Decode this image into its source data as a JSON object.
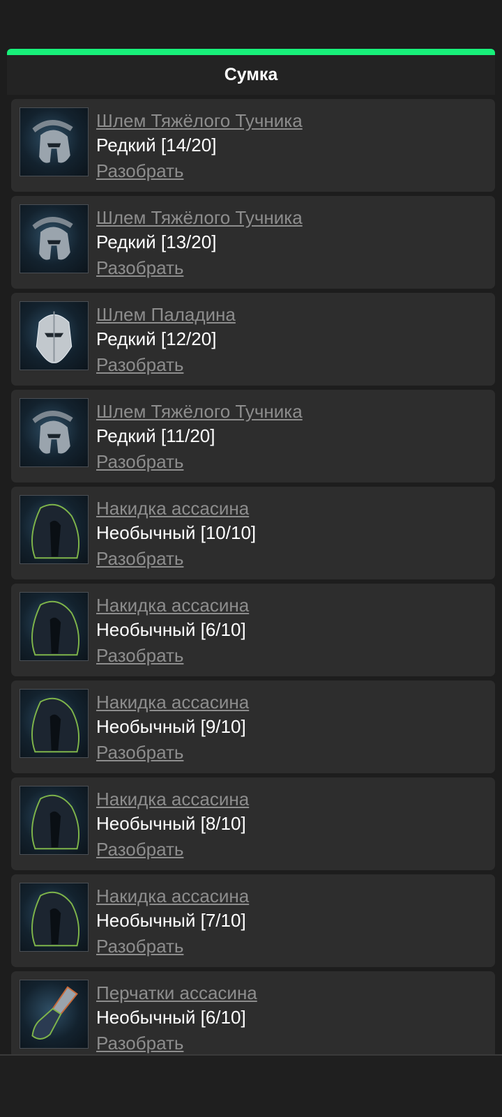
{
  "header": {
    "title": "Сумка",
    "accent": "#18f07a"
  },
  "items": [
    {
      "name": "Шлем Тяжёлого Тучника",
      "rarity": "Редкий [14/20]",
      "action": "Разобрать",
      "icon": "spartan-helmet-icon"
    },
    {
      "name": "Шлем Тяжёлого Тучника",
      "rarity": "Редкий [13/20]",
      "action": "Разобрать",
      "icon": "spartan-helmet-icon"
    },
    {
      "name": "Шлем Паладина",
      "rarity": "Редкий [12/20]",
      "action": "Разобрать",
      "icon": "paladin-helmet-icon"
    },
    {
      "name": "Шлем Тяжёлого Тучника",
      "rarity": "Редкий [11/20]",
      "action": "Разобрать",
      "icon": "spartan-helmet-icon"
    },
    {
      "name": "Накидка ассасина",
      "rarity": "Необычный [10/10]",
      "action": "Разобрать",
      "icon": "hood-icon"
    },
    {
      "name": "Накидка ассасина",
      "rarity": "Необычный [6/10]",
      "action": "Разобрать",
      "icon": "hood-icon"
    },
    {
      "name": "Накидка ассасина",
      "rarity": "Необычный [9/10]",
      "action": "Разобрать",
      "icon": "hood-icon"
    },
    {
      "name": "Накидка ассасина",
      "rarity": "Необычный [8/10]",
      "action": "Разобрать",
      "icon": "hood-icon"
    },
    {
      "name": "Накидка ассасина",
      "rarity": "Необычный [7/10]",
      "action": "Разобрать",
      "icon": "hood-icon"
    },
    {
      "name": "Перчатки ассасина",
      "rarity": "Необычный [6/10]",
      "action": "Разобрать",
      "icon": "glove-icon"
    }
  ]
}
